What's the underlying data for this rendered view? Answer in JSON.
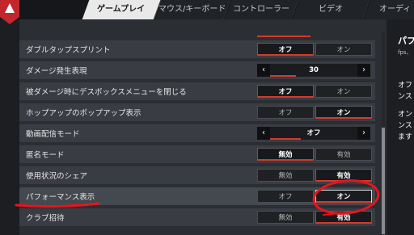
{
  "tabs": [
    {
      "label": "ゲームプレイ",
      "active": true
    },
    {
      "label": "マウス/キーボード",
      "active": false
    },
    {
      "label": "コントローラー",
      "active": false
    },
    {
      "label": "ビデオ",
      "active": false
    },
    {
      "label": "オーディ",
      "active": false
    }
  ],
  "settings": [
    {
      "label": "ダブルタップスプリント",
      "type": "toggle",
      "left": "オフ",
      "right": "オン",
      "selected": "left"
    },
    {
      "label": "ダメージ発生表現",
      "type": "stepper",
      "value": "30",
      "fill": 0.3
    },
    {
      "label": "被ダメージ時にデスボックスメニューを閉じる",
      "type": "toggle",
      "left": "オフ",
      "right": "オン",
      "selected": "left"
    },
    {
      "label": "ホップアップのポップアップ表示",
      "type": "toggle",
      "left": "オフ",
      "right": "オン",
      "selected": "right"
    },
    {
      "label": "動画配信モード",
      "type": "stepper",
      "value": "オフ",
      "fill": 0.35
    },
    {
      "label": "匿名モード",
      "type": "toggle",
      "left": "無効",
      "right": "有効",
      "selected": "left"
    },
    {
      "label": "使用状況のシェア",
      "type": "toggle",
      "left": "無効",
      "right": "有効",
      "selected": "right"
    },
    {
      "label": "パフォーマンス表示",
      "type": "toggle",
      "left": "オフ",
      "right": "オン",
      "selected": "right",
      "highlight": true
    },
    {
      "label": "クラブ招待",
      "type": "toggle",
      "left": "無効",
      "right": "有効",
      "selected": "right"
    }
  ],
  "info": {
    "title": "パフ",
    "subtitle": "fps、",
    "lines": [
      "オフ",
      "ンス",
      "オン",
      "ンス",
      "ます"
    ]
  },
  "colors": {
    "accent": "#d33a2c",
    "annotation": "#e8141e"
  }
}
